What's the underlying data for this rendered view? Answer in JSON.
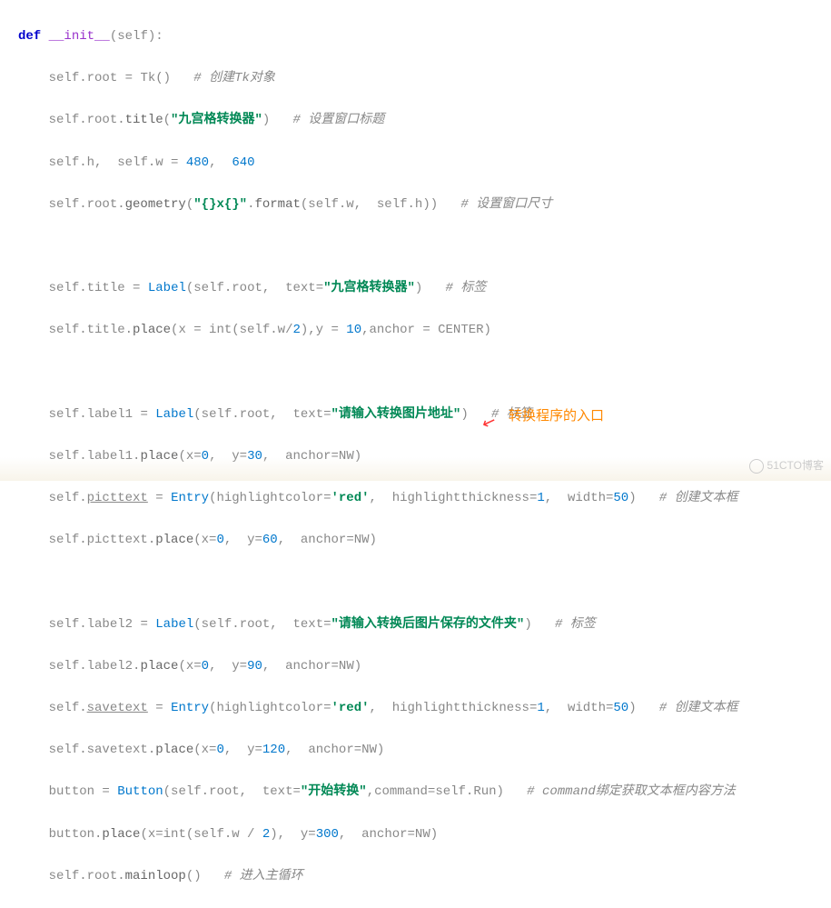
{
  "code": {
    "l1_def": "def",
    "l1_name": "__init__",
    "l1_params": "(self):",
    "l2_self": "self",
    "l2_dot": ".",
    "l2_attr": "root",
    "l2_eq": " = ",
    "l2_call": "Tk()",
    "l2_cmt": "# 创建Tk对象",
    "l3_pre": "self.root.",
    "l3_m": "title",
    "l3_open": "(",
    "l3_str": "\"九宫格转换器\"",
    "l3_close": ")",
    "l3_cmt": "# 设置窗口标题",
    "l4_pre": "self.",
    "l4_h": "h",
    "l4_sep": ",  self.",
    "l4_w": "w",
    "l4_eq": " = ",
    "l4_n1": "480",
    "l4_c": ",  ",
    "l4_n2": "640",
    "l5_pre": "self.root.",
    "l5_m": "geometry",
    "l5_open": "(",
    "l5_str": "\"{}x{}\"",
    "l5_dot": ".",
    "l5_fmt": "format",
    "l5_args": "(self.w,  self.h))",
    "l5_cmt": "# 设置窗口尺寸",
    "l7_pre": "self.",
    "l7_attr": "title",
    "l7_eq": " = ",
    "l7_cls": "Label",
    "l7_args_a": "(self.root,  text=",
    "l7_str": "\"九宫格转换器\"",
    "l7_args_b": ")",
    "l7_cmt": "# 标签",
    "l8_pre": "self.title.",
    "l8_m": "place",
    "l8_a": "(x = int(self.w/",
    "l8_n": "2",
    "l8_b": "),y = ",
    "l8_n2": "10",
    "l8_c": ",anchor = CENTER)",
    "l10_pre": "self.",
    "l10_attr": "label1",
    "l10_eq": " = ",
    "l10_cls": "Label",
    "l10_a": "(self.root,  text=",
    "l10_str": "\"请输入转换图片地址\"",
    "l10_b": ")",
    "l10_cmt": "# 标签",
    "l11_pre": "self.label1.",
    "l11_m": "place",
    "l11_a": "(x=",
    "l11_n1": "0",
    "l11_b": ",  y=",
    "l11_n2": "30",
    "l11_c": ",  anchor=NW)",
    "l12_pre": "self.",
    "l12_attr": "picttext",
    "l12_eq": " = ",
    "l12_cls": "Entry",
    "l12_a": "(highlightcolor=",
    "l12_str": "'red'",
    "l12_b": ",  highlightthickness=",
    "l12_n1": "1",
    "l12_c": ",  width=",
    "l12_n2": "50",
    "l12_d": ")",
    "l12_cmt": "# 创建文本框",
    "l13_pre": "self.picttext.",
    "l13_m": "place",
    "l13_a": "(x=",
    "l13_n1": "0",
    "l13_b": ",  y=",
    "l13_n2": "60",
    "l13_c": ",  anchor=NW)",
    "l15_pre": "self.",
    "l15_attr": "label2",
    "l15_eq": " = ",
    "l15_cls": "Label",
    "l15_a": "(self.root,  text=",
    "l15_str": "\"请输入转换后图片保存的文件夹\"",
    "l15_b": ")",
    "l15_cmt": "# 标签",
    "l16_pre": "self.label2.",
    "l16_m": "place",
    "l16_a": "(x=",
    "l16_n1": "0",
    "l16_b": ",  y=",
    "l16_n2": "90",
    "l16_c": ",  anchor=NW)",
    "l17_pre": "self.",
    "l17_attr": "savetext",
    "l17_eq": " = ",
    "l17_cls": "Entry",
    "l17_a": "(highlightcolor=",
    "l17_str": "'red'",
    "l17_b": ",  highlightthickness=",
    "l17_n1": "1",
    "l17_c": ",  width=",
    "l17_n2": "50",
    "l17_d": ")",
    "l17_cmt": "# 创建文本框",
    "l18_pre": "self.savetext.",
    "l18_m": "place",
    "l18_a": "(x=",
    "l18_n1": "0",
    "l18_b": ",  y=",
    "l18_n2": "120",
    "l18_c": ",  anchor=NW)",
    "l19_pre": "button = ",
    "l19_cls": "Button",
    "l19_a": "(self.root,  text=",
    "l19_str": "\"开始转换\"",
    "l19_b": ",command=self.",
    "l19_run": "Run",
    "l19_c": ")",
    "l19_cmt": "# command绑定获取文本框内容方法",
    "l20_pre": "button.",
    "l20_m": "place",
    "l20_a": "(x=int(self.w / ",
    "l20_n1": "2",
    "l20_b": "),  y=",
    "l20_n2": "300",
    "l20_c": ",  anchor=NW)",
    "l21_pre": "self.root.",
    "l21_m": "mainloop",
    "l21_a": "()",
    "l21_cmt": "# 进入主循环"
  },
  "annotation": "转换程序的入口",
  "watermark": "51CTO博客"
}
